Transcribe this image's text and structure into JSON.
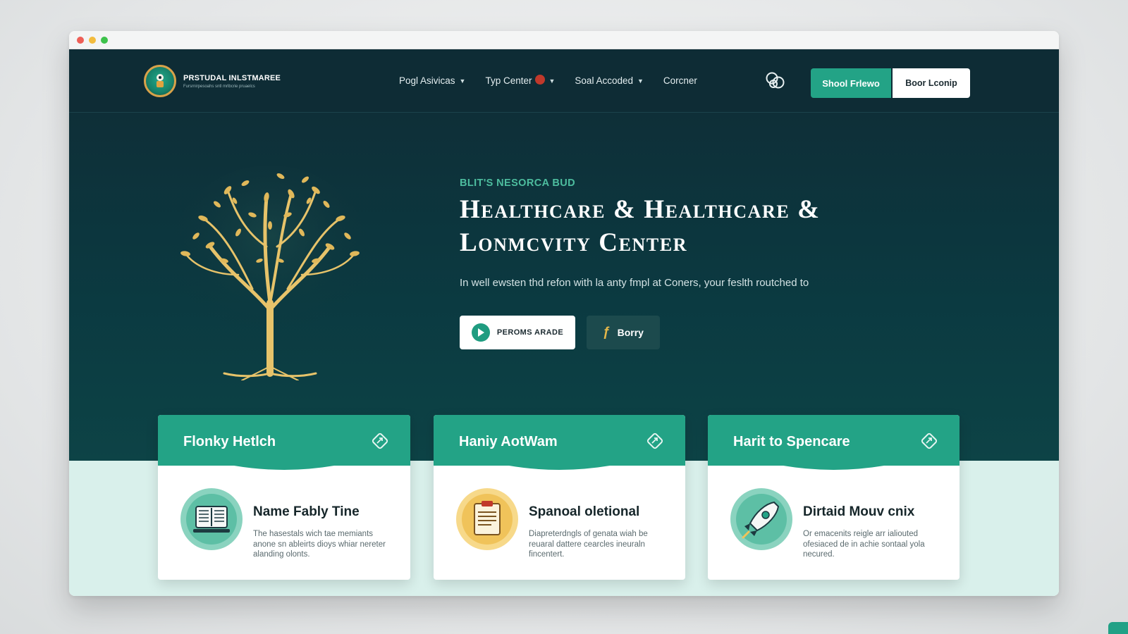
{
  "brand": {
    "name": "PRSTUDAL INLSTMAREE",
    "tagline": "Fursrnirpesoahs sntl mrlbcrie pruaelcs"
  },
  "nav": {
    "items": [
      {
        "label": "Pogl Asivicas",
        "dropdown": true
      },
      {
        "label": "Typ Center",
        "dropdown": true,
        "badge": true
      },
      {
        "label": "Soal Accoded",
        "dropdown": true
      },
      {
        "label": "Corcner",
        "dropdown": false
      }
    ],
    "icon": "linked-circles-icon",
    "cta_primary": "Shool Frlewo",
    "cta_secondary": "Boor Lconip"
  },
  "hero": {
    "eyebrow": "BLIT'S NESORCA BUD",
    "title_line1": "Healthcare & Healthcare &",
    "title_line2": "Lonmcvity Center",
    "subtitle": "In well ewsten thd refon with la anty fmpl at Coners, your feslth routched to",
    "primary_button": "PEROMS ARADE",
    "secondary_button": "Borry"
  },
  "cards": [
    {
      "title": "Flonky Hetlch",
      "subtitle": "Name Fably Tine",
      "description": "The hasestals wich tae memiants anone sn ableirts dioys whiar nereter alanding olonts.",
      "icon": "book-laptop-icon"
    },
    {
      "title": "Haniy AotWam",
      "subtitle": "Spanoal oletional",
      "description": "Diapreterdngls of genata wiah be reuaral dattere cearcles ineuraln fincentert.",
      "icon": "clipboard-icon"
    },
    {
      "title": "Harit to Spencare",
      "subtitle": "Dirtaid Mouv cnix",
      "description": "Or emacenits reigle arr ialiouted ofesiaced de in achie sontaal yola necured.",
      "icon": "rocket-icon"
    }
  ],
  "colors": {
    "navy": "#0e2c35",
    "teal": "#23a386",
    "gold": "#e4b74a",
    "mint": "#d9f0eb"
  }
}
